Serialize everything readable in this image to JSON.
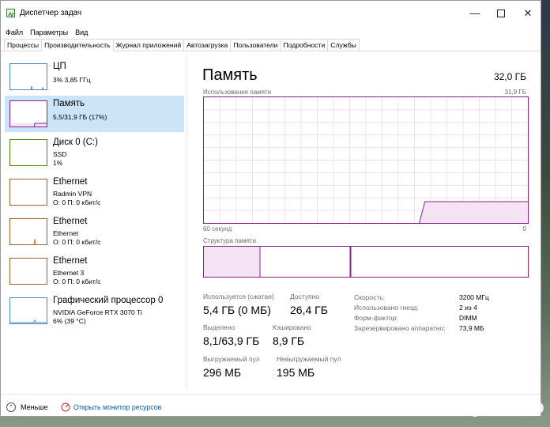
{
  "window": {
    "title": "Диспетчер задач",
    "minimize_icon": "minimize-icon",
    "maximize_icon": "maximize-icon",
    "close_icon": "close-icon"
  },
  "menu": [
    "Файл",
    "Параметры",
    "Вид"
  ],
  "tabs": [
    {
      "label": "Процессы",
      "active": false
    },
    {
      "label": "Производительность",
      "active": true
    },
    {
      "label": "Журнал приложений",
      "active": false
    },
    {
      "label": "Автозагрузка",
      "active": false
    },
    {
      "label": "Пользователи",
      "active": false
    },
    {
      "label": "Подробности",
      "active": false
    },
    {
      "label": "Службы",
      "active": false
    }
  ],
  "sidebar": {
    "items": [
      {
        "title": "ЦП",
        "lines": [
          "3% 3,85 ГГц"
        ],
        "selected": false
      },
      {
        "title": "Память",
        "lines": [
          "5,5/31,9 ГБ (17%)"
        ],
        "selected": true
      },
      {
        "title": "Диск 0 (C:)",
        "lines": [
          "SSD",
          "1%"
        ],
        "selected": false
      },
      {
        "title": "Ethernet",
        "lines": [
          "Radmin VPN",
          "О: 0 П: 0 кбит/с"
        ],
        "selected": false
      },
      {
        "title": "Ethernet",
        "lines": [
          "Ethernet",
          "О: 0 П: 0 кбит/с"
        ],
        "selected": false
      },
      {
        "title": "Ethernet",
        "lines": [
          "Ethernet 3",
          "О: 0 П: 0 кбит/с"
        ],
        "selected": false
      },
      {
        "title": "Графический процессор 0",
        "lines": [
          "NVIDIA GeForce RTX 3070 Ti",
          "6% (39 °C)"
        ],
        "selected": false
      }
    ]
  },
  "memory": {
    "title": "Память",
    "total": "32,0 ГБ",
    "usage_label": "Использование памяти",
    "usage_max": "31,9 ГБ",
    "axis_left": "60 секунд",
    "axis_right": "0",
    "structure_label": "Структура памяти",
    "used_fraction": 0.17,
    "stats": {
      "in_use_label": "Используется (сжатая)",
      "in_use_value": "5,4 ГБ (0 МБ)",
      "available_label": "Доступно",
      "available_value": "26,4 ГБ",
      "committed_label": "Выделено",
      "committed_value": "8,1/63,9 ГБ",
      "cached_label": "Кэшировано",
      "cached_value": "8,9 ГБ",
      "paged_label": "Выгружаемый пул",
      "paged_value": "296 МБ",
      "nonpaged_label": "Невыгружаемый пул",
      "nonpaged_value": "195 МБ"
    },
    "details": [
      {
        "label": "Скорость:",
        "value": "3200 МГц"
      },
      {
        "label": "Использовано гнезд:",
        "value": "2 из 4"
      },
      {
        "label": "Форм-фактор:",
        "value": "DIMM"
      },
      {
        "label": "Зарезервировано аппаратно:",
        "value": "73,9 МБ"
      }
    ]
  },
  "footer": {
    "fewer_label": "Меньше",
    "resmon_label": "Открыть монитор ресурсов"
  },
  "watermark": "Avito",
  "colors": {
    "memory": "#8b1f8b",
    "cpu": "#4a8ac9",
    "disk": "#4d8a0a",
    "ethernet": "#a0612e",
    "selected_bg": "#cce4f7",
    "link": "#0b5bb3"
  }
}
